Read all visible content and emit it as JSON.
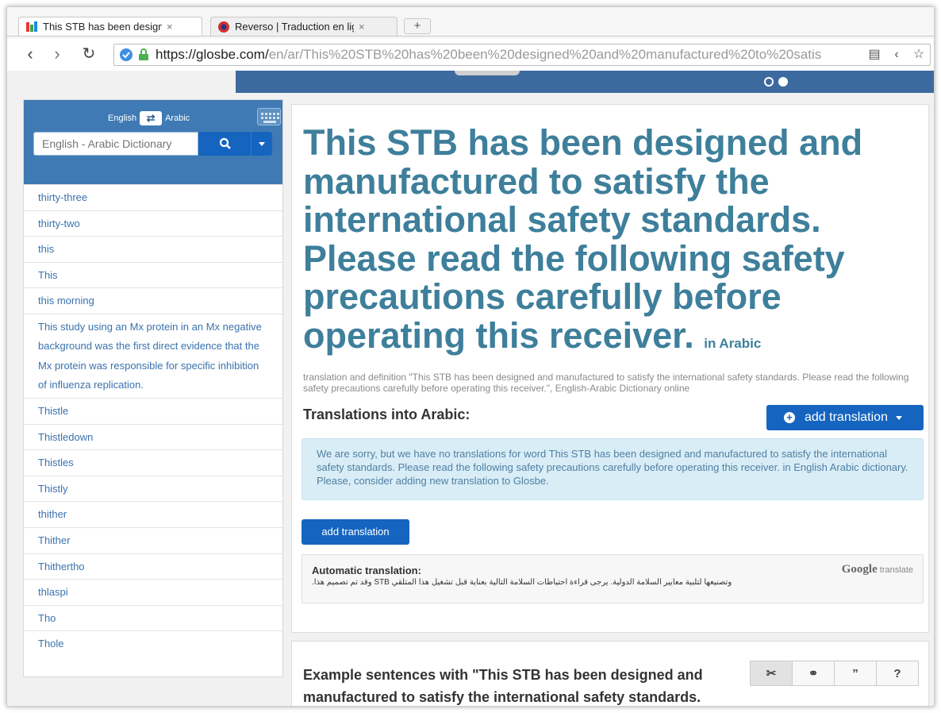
{
  "browser": {
    "tabs": [
      {
        "label": "This STB has been designe",
        "close": "×"
      },
      {
        "label": "Reverso | Traduction en lig",
        "close": "×"
      }
    ],
    "new_tab_label": "+",
    "url_host": "https://glosbe.com/",
    "url_path": "en/ar/This%20STB%20has%20been%20designed%20and%20manufactured%20to%20satis"
  },
  "sidebar": {
    "lang_from": "English",
    "lang_to": "Arabic",
    "search_placeholder": "English - Arabic Dictionary",
    "words": [
      "thirty-three",
      "thirty-two",
      "this",
      "This",
      "this morning",
      "This study using an Mx protein in an Mx negative background was the first direct evidence that the Mx protein was responsible for specific inhibition of influenza replication.",
      "Thistle",
      "Thistledown",
      "Thistles",
      "Thistly",
      "thither",
      "Thither",
      "Thithertho",
      "thlaspi",
      "Tho",
      "Thole"
    ]
  },
  "main": {
    "title": "This STB has been designed and manufactured to satisfy the international safety standards. Please read the following safety precautions carefully before operating this receiver.",
    "title_suffix": "in Arabic",
    "definition": "translation and definition \"This STB has been designed and manufactured to satisfy the international safety standards. Please read the following safety precautions carefully before operating this receiver.\", English-Arabic Dictionary  online",
    "translations_heading": "Translations into Arabic:",
    "add_translation_dropdown": "add translation",
    "no_translation_msg": "We are sorry, but we have no translations for word This STB has been designed and manufactured to satisfy the international safety standards. Please read the following safety precautions carefully before operating this receiver. in English Arabic dictionary. Please, consider adding new translation to Glosbe.",
    "add_translation_button": "add translation",
    "auto_label": "Automatic translation:",
    "auto_text": "وتصنيعها لتلبية معايير السلامة الدولية. يرجى قراءة احتياطات السلامة التالية بعناية قبل تشغيل هذا المتلقي STB وقد تم تصميم هذا.",
    "google": "Google",
    "translate_word": "translate"
  },
  "examples": {
    "title": "Example sentences with \"This STB has been designed and manufactured to satisfy the international safety standards.",
    "tools": [
      "unlink-icon",
      "link-icon",
      "quote-icon",
      "help-icon"
    ]
  },
  "colors": {
    "accent": "#1565c0",
    "title": "#3e7f9b",
    "sidebar_head": "#3f7ab5",
    "info_bg": "#d9edf7"
  }
}
